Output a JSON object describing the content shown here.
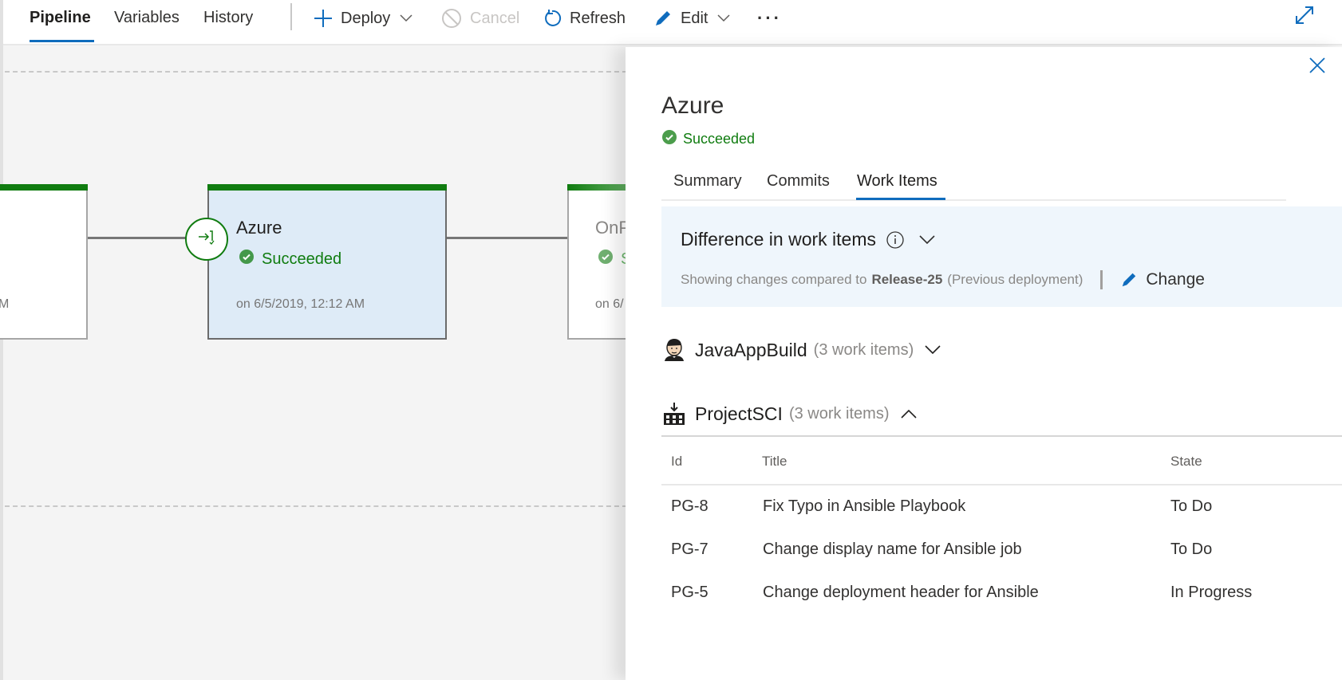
{
  "toolbar": {
    "tabs": [
      {
        "label": "Pipeline",
        "active": true
      },
      {
        "label": "Variables",
        "active": false
      },
      {
        "label": "History",
        "active": false
      }
    ],
    "actions": {
      "deploy": "Deploy",
      "cancel": "Cancel",
      "refresh": "Refresh",
      "edit": "Edit",
      "more": "···"
    },
    "icons": {
      "deploy": "plus-icon",
      "cancel": "cancel-icon",
      "refresh": "refresh-icon",
      "edit": "pencil-icon",
      "expand": "expand-icon"
    }
  },
  "pipeline": {
    "stages": [
      {
        "name": "",
        "status": "",
        "date": "M",
        "state": "succeeded"
      },
      {
        "name": "Azure",
        "status": "Succeeded",
        "date": "on 6/5/2019, 12:12 AM",
        "state": "succeeded",
        "selected": true
      },
      {
        "name": "OnP",
        "status": "S",
        "date": "on 6/",
        "state": "succeeded"
      }
    ]
  },
  "panel": {
    "title": "Azure",
    "status": "Succeeded",
    "tabs": [
      {
        "label": "Summary",
        "active": false
      },
      {
        "label": "Commits",
        "active": false
      },
      {
        "label": "Work Items",
        "active": true
      }
    ],
    "difference": {
      "title": "Difference in work items",
      "prefix": "Showing changes compared to",
      "release": "Release-25",
      "suffix": "(Previous deployment)",
      "change_label": "Change"
    },
    "artifacts": [
      {
        "name": "JavaAppBuild",
        "count": "(3 work items)",
        "icon": "jenkins-icon",
        "expanded": false
      },
      {
        "name": "ProjectSCI",
        "count": "(3 work items)",
        "icon": "build-factory-icon",
        "expanded": true
      }
    ],
    "table": {
      "columns": [
        "Id",
        "Title",
        "State"
      ],
      "rows": [
        {
          "id": "PG-8",
          "title": "Fix Typo in Ansible Playbook",
          "state": "To Do"
        },
        {
          "id": "PG-7",
          "title": "Change display name for Ansible job",
          "state": "To Do"
        },
        {
          "id": "PG-5",
          "title": "Change deployment header for Ansible",
          "state": "In Progress"
        }
      ]
    }
  },
  "colors": {
    "accent": "#0f6cbd",
    "success": "#107c10",
    "selected_card": "#deebf7",
    "diff_background": "#eff6fc"
  }
}
